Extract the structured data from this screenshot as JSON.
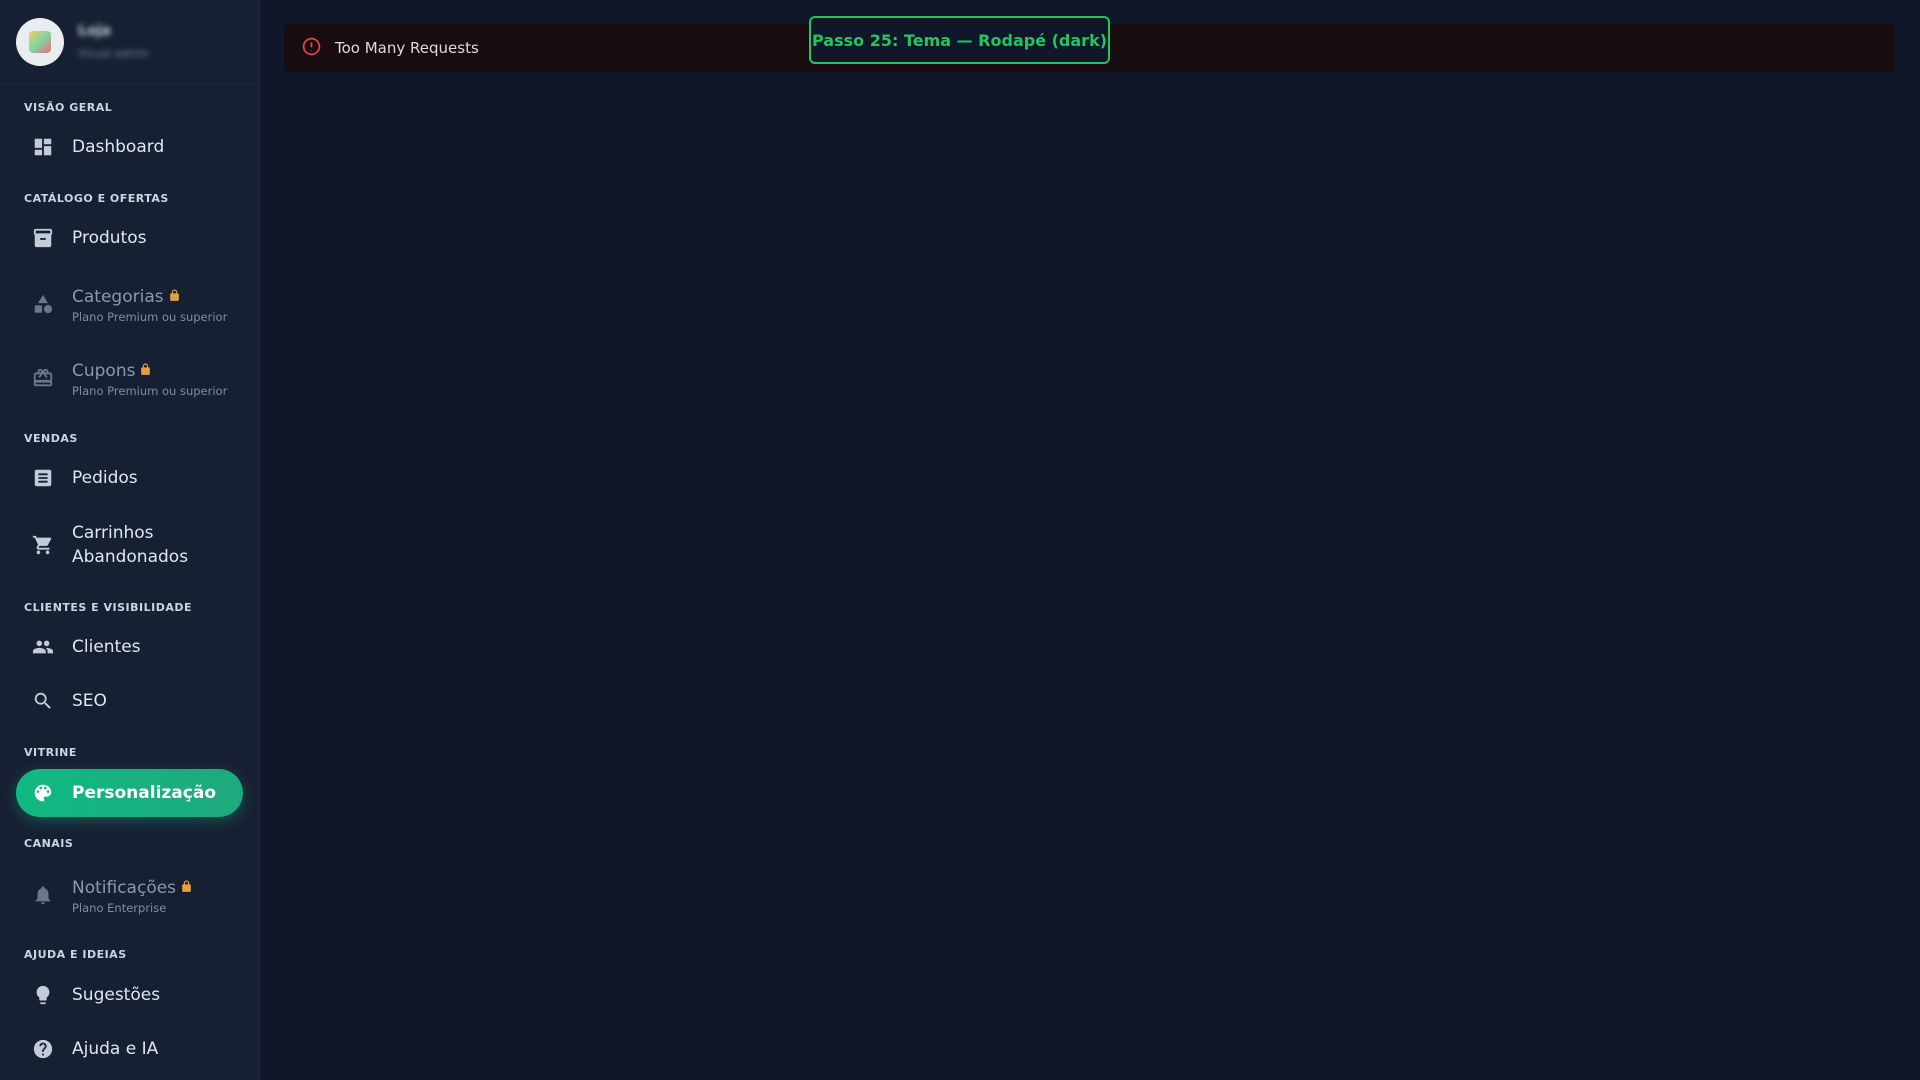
{
  "profile": {
    "name": "Loja",
    "role": "Visual admin"
  },
  "sections": {
    "overview": "VISÃO GERAL",
    "catalog": "CATÁLOGO E OFERTAS",
    "sales": "VENDAS",
    "clients": "CLIENTES E VISIBILIDADE",
    "storefront": "VITRINE",
    "channels": "CANAIS",
    "help": "AJUDA E IDEIAS"
  },
  "nav": {
    "dashboard": "Dashboard",
    "produtos": "Produtos",
    "categorias": {
      "label": "Categorias",
      "sub": "Plano Premium ou superior"
    },
    "cupons": {
      "label": "Cupons",
      "sub": "Plano Premium ou superior"
    },
    "pedidos": "Pedidos",
    "carrinhos_l1": "Carrinhos",
    "carrinhos_l2": "Abandonados",
    "clientes": "Clientes",
    "seo": "SEO",
    "personalizacao": "Personalização",
    "notificacoes": {
      "label": "Notificações",
      "sub": "Plano Enterprise"
    },
    "sugestoes": "Sugestões",
    "ajuda": "Ajuda e IA"
  },
  "alert": {
    "message": "Too Many Requests"
  },
  "step": {
    "label": "Passo 25: Tema — Rodapé (dark)"
  },
  "colors": {
    "accent": "#10b981",
    "step_badge": "#22c55e",
    "error": "#ef4444",
    "lock": "#e3a042",
    "background": "#0f1729",
    "sidebar": "#172032"
  }
}
